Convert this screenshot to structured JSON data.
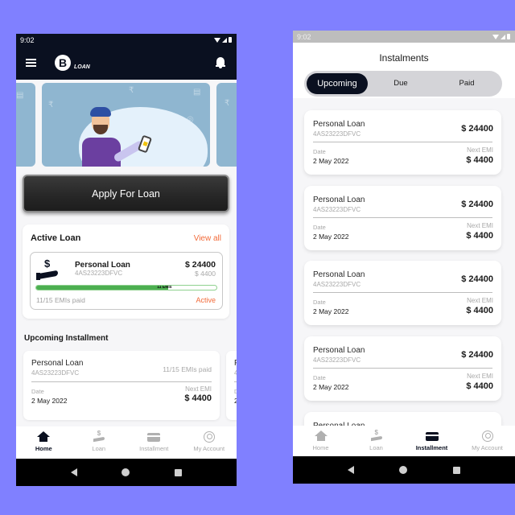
{
  "home_screen": {
    "status_bar": {
      "time": "9:02"
    },
    "app_bar": {
      "logo_letter": "B",
      "logo_text": "LOAN"
    },
    "apply_button": "Apply For Loan",
    "active_loan": {
      "title": "Active Loan",
      "view_all": "View all",
      "loan": {
        "name": "Personal Loan",
        "id": "4AS23223DFVC",
        "amount": "$ 24400",
        "emi": "$ 4400",
        "progress_label": "11 EMIs",
        "progress_fraction": 0.733,
        "paid_text": "11/15 EMIs paid",
        "status": "Active"
      }
    },
    "upcoming": {
      "title": "Upcoming Installment",
      "cards": [
        {
          "name": "Personal Loan",
          "id": "4AS23223DFVC",
          "paid": "11/15 EMIs paid",
          "date_label": "Date",
          "date": "2 May 2022",
          "next_label": "Next EMI",
          "next": "$ 4400"
        },
        {
          "name": "P",
          "id": "4",
          "paid": "",
          "date_label": "D",
          "date": "2",
          "next_label": "",
          "next": ""
        }
      ]
    },
    "bottom_nav": [
      {
        "label": "Home",
        "icon": "home-icon",
        "active": true
      },
      {
        "label": "Loan",
        "icon": "loan-icon",
        "active": false
      },
      {
        "label": "Installment",
        "icon": "card-icon",
        "active": false
      },
      {
        "label": "My Account",
        "icon": "account-icon",
        "active": false
      }
    ]
  },
  "instalments_screen": {
    "status_bar": {
      "time": "9:02"
    },
    "title": "Instalments",
    "tabs": [
      {
        "label": "Upcoming",
        "active": true
      },
      {
        "label": "Due",
        "active": false
      },
      {
        "label": "Paid",
        "active": false
      }
    ],
    "cards": [
      {
        "name": "Personal Loan",
        "id": "4AS23223DFVC",
        "total": "$ 24400",
        "date_label": "Date",
        "date": "2 May 2022",
        "next_label": "Next EMI",
        "next": "$ 4400"
      },
      {
        "name": "Personal Loan",
        "id": "4AS23223DFVC",
        "total": "$ 24400",
        "date_label": "Date",
        "date": "2 May 2022",
        "next_label": "Next EMI",
        "next": "$ 4400"
      },
      {
        "name": "Personal Loan",
        "id": "4AS23223DFVC",
        "total": "$ 24400",
        "date_label": "Date",
        "date": "2 May 2022",
        "next_label": "Next EMI",
        "next": "$ 4400"
      },
      {
        "name": "Personal Loan",
        "id": "4AS23223DFVC",
        "total": "$ 24400",
        "date_label": "Date",
        "date": "2 May 2022",
        "next_label": "Next EMI",
        "next": "$ 4400"
      },
      {
        "name": "Personal Loan",
        "id": "",
        "total": "",
        "date_label": "",
        "date": "",
        "next_label": "",
        "next": ""
      }
    ],
    "bottom_nav": [
      {
        "label": "Home",
        "icon": "home-icon",
        "active": false
      },
      {
        "label": "Loan",
        "icon": "loan-icon",
        "active": false
      },
      {
        "label": "Installment",
        "icon": "card-icon",
        "active": true
      },
      {
        "label": "My Account",
        "icon": "account-icon",
        "active": false
      }
    ]
  },
  "colors": {
    "background": "#8080FF",
    "primary_dark": "#0a1020",
    "accent_orange": "#f26b3a",
    "progress_green": "#4caf50"
  }
}
